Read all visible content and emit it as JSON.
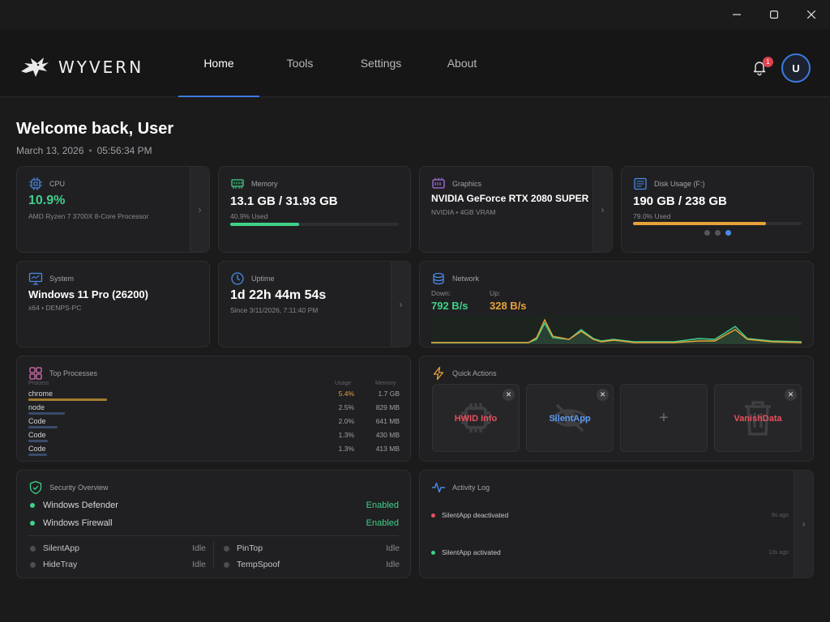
{
  "window": {
    "minimize": "minimize",
    "maximize": "maximize",
    "close": "close"
  },
  "app": {
    "logo_text": "WYVERN"
  },
  "nav": {
    "tabs": [
      {
        "label": "Home",
        "active": true
      },
      {
        "label": "Tools"
      },
      {
        "label": "Settings"
      },
      {
        "label": "About"
      }
    ]
  },
  "header": {
    "notification_count": "1",
    "avatar_initial": "U"
  },
  "welcome": {
    "title": "Welcome back, User",
    "date": "March 13, 2026",
    "time": "05:56:34 PM"
  },
  "cpu": {
    "label": "CPU",
    "value": "10.9%",
    "detail": "AMD Ryzen 7 3700X 8-Core Processor"
  },
  "memory": {
    "label": "Memory",
    "value": "13.1 GB / 31.93 GB",
    "detail": "40.9% Used",
    "fraction": 0.409
  },
  "graphics": {
    "label": "Graphics",
    "value": "NVIDIA GeForce RTX 2080 SUPER",
    "detail": "NVIDIA • 4GB VRAM"
  },
  "disk": {
    "label": "Disk Usage (F:)",
    "value": "190 GB / 238 GB",
    "detail": "79.0% Used",
    "fraction": 0.79,
    "pages": 3,
    "active_page": 3
  },
  "system": {
    "label": "System",
    "value": "Windows 11 Pro (26200)",
    "detail": "x64 • DENPS-PC"
  },
  "uptime": {
    "label": "Uptime",
    "value": "1d 22h 44m 54s",
    "detail": "Since 3/11/2026, 7:11:40 PM"
  },
  "network": {
    "label": "Network",
    "down_label": "Down:",
    "down_value": "792 B/s",
    "up_label": "Up:",
    "up_value": "328 B/s",
    "colors": {
      "down": "#3fd18a",
      "up": "#e8a23a"
    }
  },
  "processes": {
    "title": "Top Processes",
    "columns": {
      "process": "Process",
      "usage": "Usage",
      "memory": "Memory"
    },
    "rows": [
      {
        "name": "chrome",
        "usage": "5.4%",
        "memory": "1.7 GB",
        "fraction": 1.0,
        "highlight": true
      },
      {
        "name": "node",
        "usage": "2.5%",
        "memory": "829 MB",
        "fraction": 0.46
      },
      {
        "name": "Code",
        "usage": "2.0%",
        "memory": "641 MB",
        "fraction": 0.37
      },
      {
        "name": "Code",
        "usage": "1.3%",
        "memory": "430 MB",
        "fraction": 0.25
      },
      {
        "name": "Code",
        "usage": "1.3%",
        "memory": "413 MB",
        "fraction": 0.24
      }
    ]
  },
  "quick_actions": {
    "title": "Quick Actions",
    "tiles": [
      {
        "label": "HWID Info",
        "color": "#e8505b",
        "icon": "chip-icon"
      },
      {
        "label": "SilentApp",
        "color": "#5b9bf0",
        "icon": "eye-off-icon"
      },
      {
        "label": "+",
        "icon": "plus-icon"
      },
      {
        "label": "VanishData",
        "color": "#e8505b",
        "icon": "trash-icon"
      }
    ]
  },
  "security": {
    "title": "Security Overview",
    "main": [
      {
        "name": "Windows Defender",
        "status": "Enabled"
      },
      {
        "name": "Windows Firewall",
        "status": "Enabled"
      }
    ],
    "tools_left": [
      {
        "name": "SilentApp",
        "status": "Idle"
      },
      {
        "name": "HideTray",
        "status": "Idle"
      }
    ],
    "tools_right": [
      {
        "name": "PinTop",
        "status": "Idle"
      },
      {
        "name": "TempSpoof",
        "status": "Idle"
      }
    ]
  },
  "activity": {
    "title": "Activity Log",
    "entries": [
      {
        "text": "SilentApp deactivated",
        "time": "8s ago",
        "color": "#e8505b"
      },
      {
        "text": "SilentApp activated",
        "time": "13s ago",
        "color": "#3fd18a"
      }
    ]
  }
}
